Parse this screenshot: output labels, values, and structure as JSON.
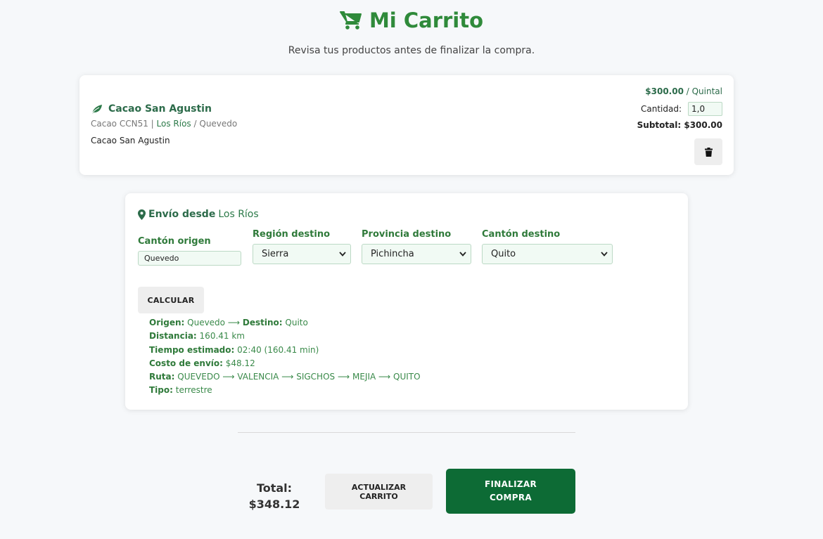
{
  "header": {
    "title": "Mi Carrito",
    "subtitle": "Revisa tus productos antes de finalizar la compra.",
    "icon": "cart-icon"
  },
  "product": {
    "name": "Cacao San Agustin",
    "variety": "Cacao CCN51",
    "province": "Los Ríos",
    "canton": "Quevedo",
    "description": "Cacao San Agustin",
    "price": "$300.00",
    "unit": "Quintal",
    "quantity_label": "Cantidad:",
    "quantity": "1,0",
    "subtotal_label": "Subtotal:",
    "subtotal": "$300.00",
    "icon": "leaf-icon"
  },
  "shipping": {
    "title_prefix": "Envío desde",
    "title_location": "Los Ríos",
    "origin_label": "Cantón origen",
    "origin_value": "Quevedo",
    "region_label": "Región destino",
    "region_value": "Sierra",
    "province_label": "Provincia destino",
    "province_value": "Pichincha",
    "canton_label": "Cantón destino",
    "canton_value": "Quito",
    "calculate_label": "CALCULAR",
    "results": {
      "origin_label": "Origen:",
      "origin": "Quevedo",
      "arrow": "⟶",
      "dest_label": "Destino:",
      "dest": "Quito",
      "distance_label": "Distancia:",
      "distance": "160.41 km",
      "time_label": "Tiempo estimado:",
      "time": "02:40 (160.41 min)",
      "cost_label": "Costo de envío:",
      "cost": "$48.12",
      "route_label": "Ruta:",
      "route": "QUEVEDO ⟶ VALENCIA ⟶ SIGCHOS ⟶ MEJIA ⟶ QUITO",
      "type_label": "Tipo:",
      "type": "terrestre"
    }
  },
  "footer": {
    "total_label": "Total:",
    "total": "$348.12",
    "update_line1": "ACTUALIZAR",
    "update_line2": "CARRITO",
    "finalize_line1": "FINALIZAR",
    "finalize_line2": "COMPRA"
  },
  "colors": {
    "primary": "#2f8a3a",
    "button_dark": "#0d6b35",
    "background": "#f6f8fa"
  }
}
